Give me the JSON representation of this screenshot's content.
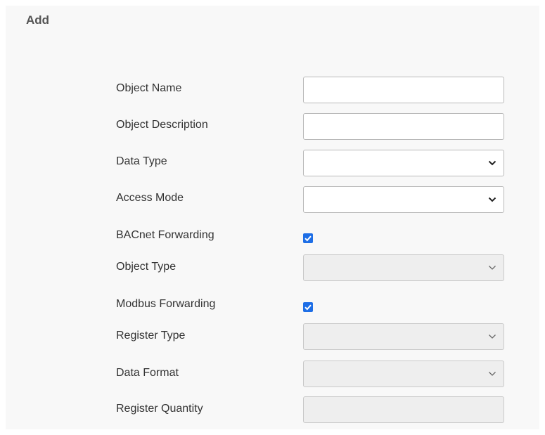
{
  "header": {
    "title": "Add"
  },
  "form": {
    "object_name": {
      "label": "Object Name",
      "value": ""
    },
    "object_description": {
      "label": "Object Description",
      "value": ""
    },
    "data_type": {
      "label": "Data Type",
      "selected": ""
    },
    "access_mode": {
      "label": "Access Mode",
      "selected": ""
    },
    "bacnet_forwarding": {
      "label": "BACnet Forwarding",
      "checked": true
    },
    "object_type": {
      "label": "Object Type",
      "selected": "",
      "disabled": true
    },
    "modbus_forwarding": {
      "label": "Modbus Forwarding",
      "checked": true
    },
    "register_type": {
      "label": "Register Type",
      "selected": "",
      "disabled": true
    },
    "data_format": {
      "label": "Data Format",
      "selected": "",
      "disabled": true
    },
    "register_quantity": {
      "label": "Register Quantity",
      "value": "",
      "disabled": true
    }
  },
  "icons": {
    "dropdown": "chevron-down-icon",
    "checkbox": "checkmark-icon"
  },
  "colors": {
    "checkbox_accent": "#1e6ee6",
    "panel_background": "#f8f8f8",
    "disabled_field": "#eeeeee"
  }
}
